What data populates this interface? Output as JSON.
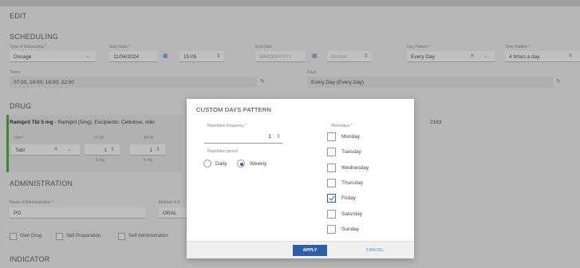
{
  "header": {
    "title": "EDIT"
  },
  "scheduling": {
    "title": "SCHEDULING",
    "type_label": "Type of Scheduling *",
    "type_value": "Dosage",
    "start_label": "Start Date *",
    "start_date": "11/04/2024",
    "start_time": "15:05",
    "end_label": "End Date",
    "end_date_placeholder": "MM/DD/YYYY",
    "end_time_placeholder": "hh:mm",
    "day_pattern_label": "Day Pattern *",
    "day_pattern_value": "Every Day",
    "time_pattern_label": "Time Pattern *",
    "time_pattern_value": "4 times a day",
    "times_label": "Times",
    "times_value": "07:00, 14:00, 18:00, 22:00",
    "days_label": "Days",
    "days_value": "Every Day (Every Day)"
  },
  "drug": {
    "title": "DRUG",
    "name": "Ramipril Tbl 5 mg",
    "description": " - Ramipril (5mg), Excipients: Cellulose, mikr",
    "code": "2163",
    "unit_label": "Unit *",
    "unit_value": "Tabl",
    "col1_label": "07:00",
    "col1_value": "1",
    "col1_sub": "5 mg",
    "col2_label": "14:00",
    "col2_value": "1",
    "col2_sub": "5 mg"
  },
  "administration": {
    "title": "ADMINISTRATION",
    "route_label": "Route of Administration *",
    "route_value": "PO",
    "method_label": "Method of A",
    "method_value": "ORAL",
    "own_drug": "Own Drug",
    "self_prep": "Self Preparation",
    "self_admin": "Self Administration"
  },
  "indicator": {
    "title": "INDICATOR"
  },
  "dialog": {
    "title": "CUSTOM DAYS PATTERN",
    "repetition_label": "Repetition frequency *",
    "repetition_value": "1",
    "period_label": "Repetition period",
    "period_daily": "Daily",
    "period_weekly": "Weekly",
    "weekdays_label": "Weekdays *",
    "weekdays": [
      {
        "label": "Monday",
        "checked": false
      },
      {
        "label": "Tuesday",
        "checked": false
      },
      {
        "label": "Wednesday",
        "checked": false
      },
      {
        "label": "Thursday",
        "checked": false
      },
      {
        "label": "Friday",
        "checked": true
      },
      {
        "label": "Saturday",
        "checked": false
      },
      {
        "label": "Sunday",
        "checked": false
      }
    ],
    "apply_label": "APPLY",
    "cancel_label": "CANCEL"
  },
  "colors": {
    "accent": "#2f5da8",
    "drug_marker": "#3caa3c"
  }
}
